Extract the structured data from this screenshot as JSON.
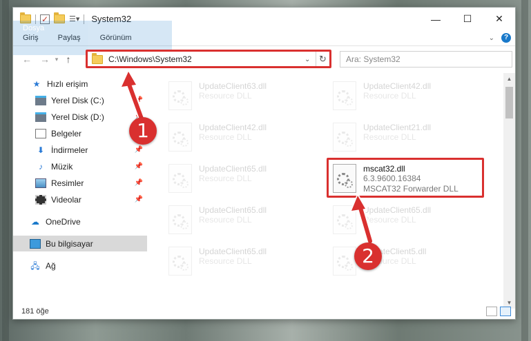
{
  "window": {
    "title": "System32",
    "controls": [
      "minimize",
      "maximize",
      "close"
    ]
  },
  "ribbon": {
    "tabs": [
      "Dosya",
      "Giriş",
      "Paylaş",
      "Görünüm"
    ],
    "help_label": "?"
  },
  "address_bar": {
    "path": "C:\\Windows\\System32",
    "search_placeholder": "Ara: System32"
  },
  "sidebar": {
    "quick_access": "Hızlı erişim",
    "items": [
      {
        "label": "Yerel Disk (C:)",
        "icon": "drive-icon",
        "pinned": true
      },
      {
        "label": "Yerel Disk (D:)",
        "icon": "drive-icon",
        "pinned": true
      },
      {
        "label": "Belgeler",
        "icon": "documents-icon",
        "pinned": true
      },
      {
        "label": "İndirmeler",
        "icon": "downloads-icon",
        "pinned": true
      },
      {
        "label": "Müzik",
        "icon": "music-icon",
        "pinned": true
      },
      {
        "label": "Resimler",
        "icon": "pictures-icon",
        "pinned": true
      },
      {
        "label": "Videolar",
        "icon": "videos-icon",
        "pinned": true
      }
    ],
    "onedrive": "OneDrive",
    "this_pc": "Bu bilgisayar",
    "network": "Ağ"
  },
  "files": [
    {
      "name": "UpdateClient63.dll",
      "type": "Resource DLL"
    },
    {
      "name": "UpdateClient42.dll",
      "type": "Resource DLL"
    },
    {
      "name": "UpdateClient42.dll",
      "type": "Resource DLL"
    },
    {
      "name": "UpdateClient21.dll",
      "type": "Resource DLL"
    },
    {
      "name": "UpdateClient65.dll",
      "type": "Resource DLL"
    },
    {
      "name": "mscat32.dll",
      "version": "6.3.9600.16384",
      "type": "MSCAT32 Forwarder DLL"
    },
    {
      "name": "UpdateClient65.dll",
      "type": "Resource DLL"
    },
    {
      "name": "UpdateClient65.dll",
      "type": "Resource DLL"
    },
    {
      "name": "UpdateClient65.dll",
      "type": "Resource DLL"
    },
    {
      "name": "UpdateClient5.dll",
      "type": "Resource DLL"
    }
  ],
  "status_bar": {
    "count": "181 öğe"
  },
  "callouts": [
    "1",
    "2"
  ],
  "colors": {
    "accent": "#1979ca",
    "highlight": "#d9302f"
  }
}
